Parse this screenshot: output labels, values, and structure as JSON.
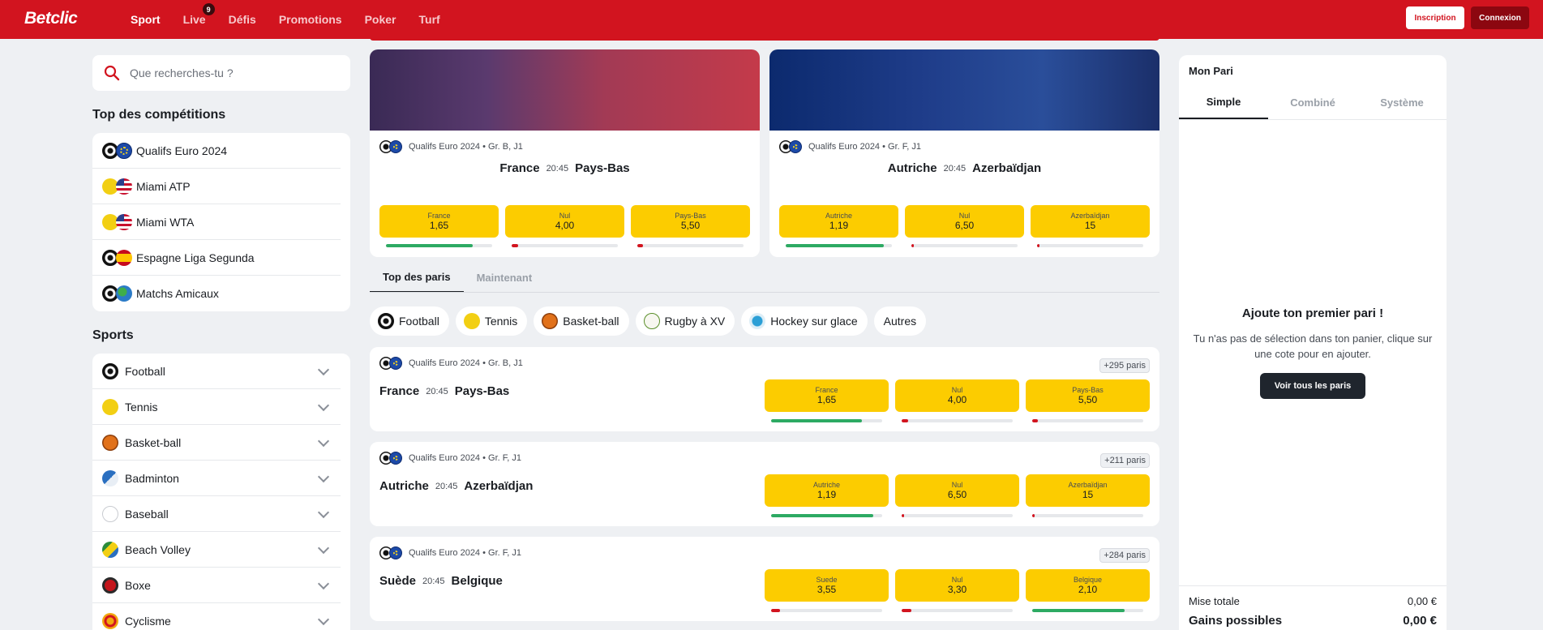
{
  "header": {
    "logo": "Betclic",
    "nav": [
      {
        "label": "Sport",
        "active": true
      },
      {
        "label": "Live",
        "badge": "9"
      },
      {
        "label": "Défis"
      },
      {
        "label": "Promotions"
      },
      {
        "label": "Poker"
      },
      {
        "label": "Turf"
      }
    ],
    "signup_label": "Inscription",
    "login_label": "Connexion",
    "brand_color": "#d2141f"
  },
  "sidebar": {
    "search_placeholder": "Que recherches-tu ?",
    "top_title": "Top des compétitions",
    "competitions": [
      {
        "label": "Qualifs Euro 2024",
        "icons": [
          "soccer-ball-icon",
          "europe-flag-icon"
        ]
      },
      {
        "label": "Miami ATP",
        "icons": [
          "tennis-ball-icon",
          "usa-flag-icon"
        ]
      },
      {
        "label": "Miami WTA",
        "icons": [
          "tennis-ball-icon",
          "usa-flag-icon"
        ]
      },
      {
        "label": "Espagne Liga Segunda",
        "icons": [
          "soccer-ball-icon",
          "spain-flag-icon"
        ]
      },
      {
        "label": "Matchs Amicaux",
        "icons": [
          "soccer-ball-icon",
          "world-icon"
        ]
      }
    ],
    "sports_title": "Sports",
    "sports": [
      {
        "label": "Football",
        "icon": "soccer-ball-icon"
      },
      {
        "label": "Tennis",
        "icon": "tennis-ball-icon"
      },
      {
        "label": "Basket-ball",
        "icon": "basketball-icon"
      },
      {
        "label": "Badminton",
        "icon": "shuttlecock-icon"
      },
      {
        "label": "Baseball",
        "icon": "baseball-icon"
      },
      {
        "label": "Beach Volley",
        "icon": "volleyball-icon"
      },
      {
        "label": "Boxe",
        "icon": "boxing-glove-icon"
      },
      {
        "label": "Cyclisme",
        "icon": "bicycle-icon"
      }
    ]
  },
  "featured": [
    {
      "competition": "Qualifs Euro 2024 • Gr. B, J1",
      "home": "France",
      "time": "20:45",
      "away": "Pays-Bas",
      "odds": [
        {
          "label": "France",
          "value": "1,65",
          "share": 0.82
        },
        {
          "label": "Nul",
          "value": "4,00",
          "share": 0.06
        },
        {
          "label": "Pays-Bas",
          "value": "5,50",
          "share": 0.05
        }
      ]
    },
    {
      "competition": "Qualifs Euro 2024 • Gr. F, J1",
      "home": "Autriche",
      "time": "20:45",
      "away": "Azerbaïdjan",
      "odds": [
        {
          "label": "Autriche",
          "value": "1,19",
          "share": 0.92
        },
        {
          "label": "Nul",
          "value": "6,50",
          "share": 0.01
        },
        {
          "label": "Azerbaïdjan",
          "value": "15",
          "share": 0.02
        }
      ]
    }
  ],
  "tabs": [
    {
      "label": "Top des paris",
      "active": true
    },
    {
      "label": "Maintenant"
    }
  ],
  "sport_filters": [
    {
      "label": "Football",
      "icon": "soccer-ball-icon"
    },
    {
      "label": "Tennis",
      "icon": "tennis-ball-icon"
    },
    {
      "label": "Basket-ball",
      "icon": "basketball-icon"
    },
    {
      "label": "Rugby à XV",
      "icon": "rugby-ball-icon"
    },
    {
      "label": "Hockey sur glace",
      "icon": "hockey-puck-icon"
    },
    {
      "label": "Autres"
    }
  ],
  "matches": [
    {
      "competition": "Qualifs Euro 2024 • Gr. B, J1",
      "home": "France",
      "time": "20:45",
      "away": "Pays-Bas",
      "paris": "+295 paris",
      "odds": [
        {
          "label": "France",
          "value": "1,65",
          "share": 0.82
        },
        {
          "label": "Nul",
          "value": "4,00",
          "share": 0.06
        },
        {
          "label": "Pays-Bas",
          "value": "5,50",
          "share": 0.05
        }
      ]
    },
    {
      "competition": "Qualifs Euro 2024 • Gr. F, J1",
      "home": "Autriche",
      "time": "20:45",
      "away": "Azerbaïdjan",
      "paris": "+211 paris",
      "odds": [
        {
          "label": "Autriche",
          "value": "1,19",
          "share": 0.92
        },
        {
          "label": "Nul",
          "value": "6,50",
          "share": 0.01
        },
        {
          "label": "Azerbaïdjan",
          "value": "15",
          "share": 0.02
        }
      ]
    },
    {
      "competition": "Qualifs Euro 2024 • Gr. F, J1",
      "home": "Suède",
      "time": "20:45",
      "away": "Belgique",
      "paris": "+284 paris",
      "odds": [
        {
          "label": "Suede",
          "value": "3,55",
          "share": 0.08
        },
        {
          "label": "Nul",
          "value": "3,30",
          "share": 0.09
        },
        {
          "label": "Belgique",
          "value": "2,10",
          "share": 0.83
        }
      ]
    }
  ],
  "betslip": {
    "title": "Mon Pari",
    "tabs": [
      {
        "label": "Simple",
        "active": true
      },
      {
        "label": "Combiné"
      },
      {
        "label": "Système"
      }
    ],
    "empty_title": "Ajoute ton premier pari !",
    "empty_text": "Tu n'as pas de sélection dans ton panier, clique sur une cote pour en ajouter.",
    "cta_label": "Voir tous les paris",
    "stake_label": "Mise totale",
    "stake_value": "0,00 €",
    "gain_label": "Gains possibles",
    "gain_value": "0,00 €"
  }
}
